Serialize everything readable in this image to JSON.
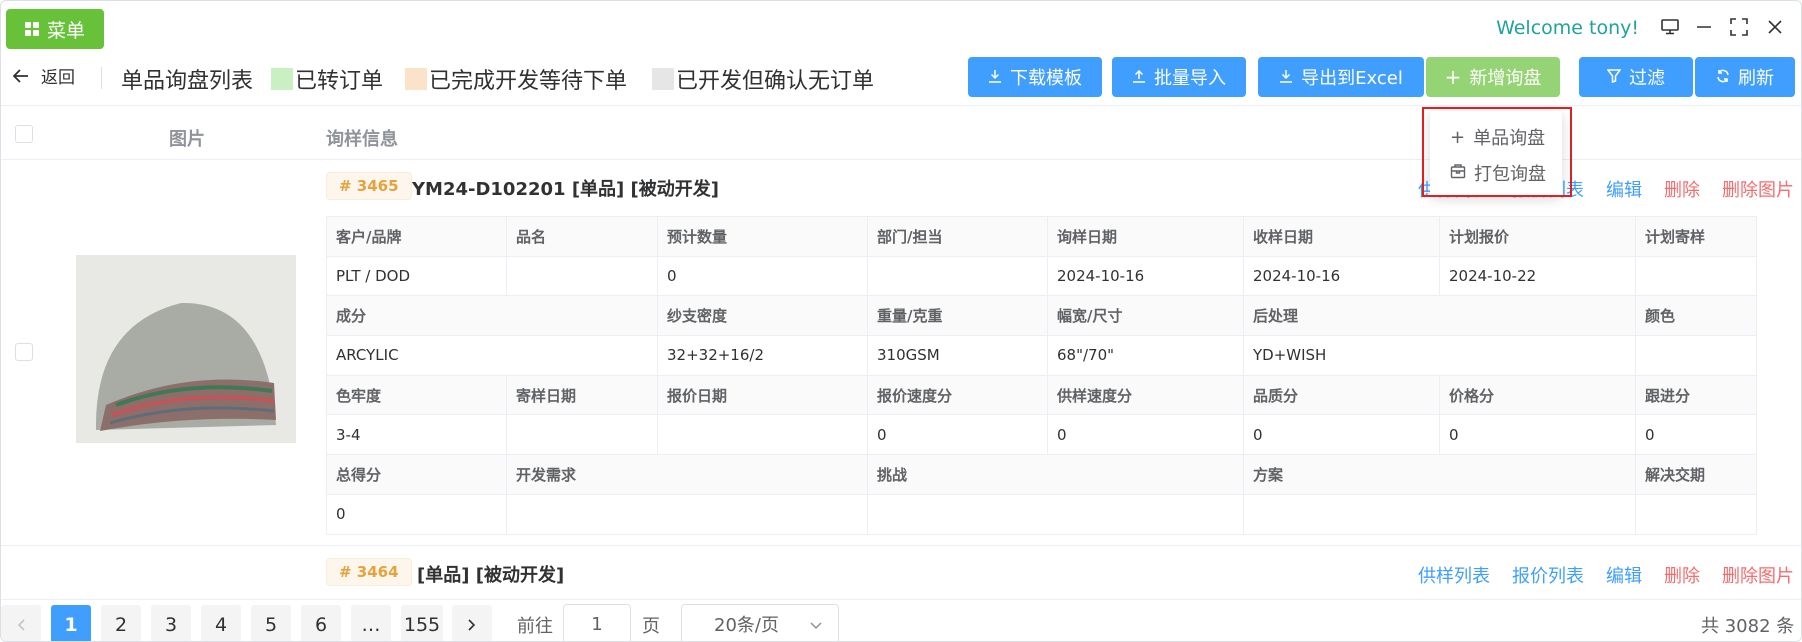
{
  "topbar": {
    "menu_label": "菜单",
    "welcome": "Welcome tony!"
  },
  "header": {
    "back_label": "返回",
    "title": "单品询盘列表",
    "legend": [
      {
        "label": "已转订单",
        "color": "#c9efc2"
      },
      {
        "label": "已完成开发等待下单",
        "color": "#fae3c8"
      },
      {
        "label": "已开发但确认无订单",
        "color": "#e6e6e6"
      }
    ],
    "buttons": {
      "download_template": "下载模板",
      "batch_import": "批量导入",
      "export_excel": "导出到Excel",
      "new_inquiry": "新增询盘",
      "filter": "过滤",
      "refresh": "刷新"
    }
  },
  "dropdown": {
    "items": [
      "单品询盘",
      "打包询盘"
    ]
  },
  "table_header": {
    "image": "图片",
    "info": "询样信息"
  },
  "records": [
    {
      "no": "# 3465",
      "title": "YM24-D102201 [单品] [被动开发]",
      "actions": {
        "supply": "供样列表",
        "quote": "报价列表",
        "edit": "编辑",
        "delete": "删除",
        "delete_image": "删除图片"
      },
      "rows": [
        [
          "客户/品牌",
          "品名",
          "预计数量",
          "部门/担当",
          "询样日期",
          "收样日期",
          "计划报价",
          "计划寄样"
        ],
        [
          "PLT / DOD",
          "",
          "0",
          "",
          "2024-10-16",
          "2024-10-16",
          "2024-10-22",
          ""
        ],
        [
          "成分",
          "纱支密度",
          "重量/克重",
          "幅宽/尺寸",
          "后处理",
          "颜色"
        ],
        [
          "ARCYLIC",
          "32+32+16/2",
          "310GSM",
          "68\"/70\"",
          "YD+WISH",
          ""
        ],
        [
          "色牢度",
          "寄样日期",
          "报价日期",
          "报价速度分",
          "供样速度分",
          "品质分",
          "价格分",
          "跟进分"
        ],
        [
          "3-4",
          "",
          "",
          "0",
          "0",
          "0",
          "0",
          "0"
        ],
        [
          "总得分",
          "开发需求",
          "挑战",
          "方案",
          "解决交期"
        ],
        [
          "0",
          "",
          "",
          "",
          ""
        ]
      ]
    },
    {
      "no": "# 3464",
      "title": "[单品] [被动开发]",
      "actions": {
        "supply": "供样列表",
        "quote": "报价列表",
        "edit": "编辑",
        "delete": "删除",
        "delete_image": "删除图片"
      }
    }
  ],
  "pagination": {
    "pages": [
      "1",
      "2",
      "3",
      "4",
      "5",
      "6",
      "…",
      "155"
    ],
    "goto_label": "前往",
    "goto_value": "1",
    "page_unit": "页",
    "page_size": "20条/页",
    "total": "共 3082 条"
  }
}
